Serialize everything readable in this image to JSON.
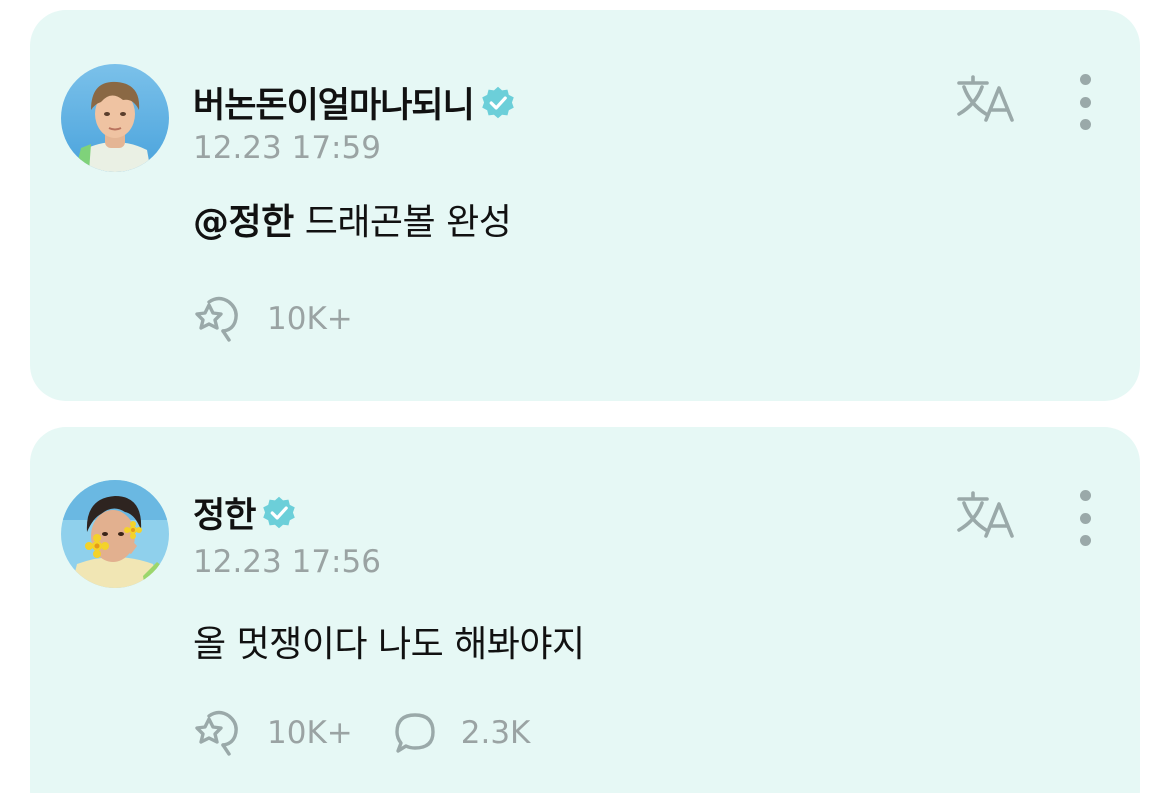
{
  "colors": {
    "card_background": "#e6f8f5",
    "verified_badge": "#6ccfd9",
    "muted_text": "#9aa3a3",
    "icon": "#9aa9a9"
  },
  "posts": [
    {
      "author": "버논돈이얼마나되니",
      "verified": true,
      "timestamp": "12.23 17:59",
      "mention": "@정한",
      "body": " 드래곤볼 완성",
      "reactions": {
        "icon": "cheer-icon",
        "count": "10K+"
      },
      "actions": [
        "translate-icon",
        "more-options-icon"
      ]
    },
    {
      "author": "정한",
      "verified": true,
      "timestamp": "12.23 17:56",
      "body": "올 멋쟁이다 나도 해봐야지",
      "reactions": {
        "icon": "cheer-icon",
        "count": "10K+"
      },
      "comments": {
        "icon": "comment-icon",
        "count": "2.3K"
      },
      "actions": [
        "translate-icon",
        "more-options-icon"
      ]
    }
  ]
}
